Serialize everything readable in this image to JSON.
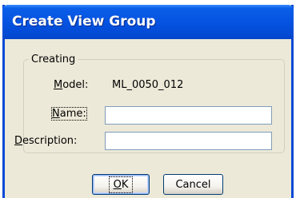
{
  "window": {
    "title": "Create View Group"
  },
  "group": {
    "legend": "Creating"
  },
  "model": {
    "label": "Model:",
    "mnemonic": "M",
    "label_rest": "odel:",
    "value": "ML_0050_012"
  },
  "name": {
    "label": "Name:",
    "mnemonic": "N",
    "label_rest": "ame:",
    "value": ""
  },
  "description": {
    "label": "Description:",
    "mnemonic": "D",
    "label_rest": "escription:",
    "value": ""
  },
  "buttons": {
    "ok": {
      "mnemonic": "O",
      "label_rest": "K"
    },
    "cancel": {
      "label": "Cancel"
    }
  },
  "colors": {
    "titlebar": "#0552e0",
    "dialog_bg": "#ece9d8",
    "frame": "#0a49d6"
  }
}
